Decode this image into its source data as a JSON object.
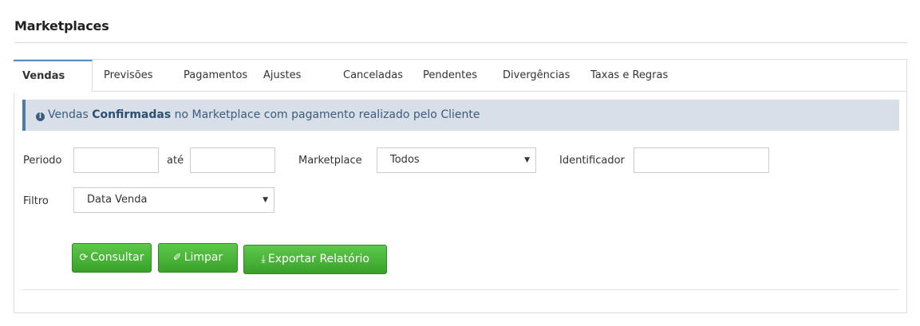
{
  "page": {
    "title": "Marketplaces"
  },
  "tabs": [
    {
      "label": "Vendas"
    },
    {
      "label": "Previsões"
    },
    {
      "label": "Pagamentos"
    },
    {
      "label": "Ajustes"
    },
    {
      "label": "Canceladas"
    },
    {
      "label": "Pendentes"
    },
    {
      "label": "Divergências"
    },
    {
      "label": "Taxas e Regras"
    }
  ],
  "active_tab": "Vendas",
  "info": {
    "icon": "info-circle-icon",
    "text_before": "Vendas ",
    "text_bold": "Confirmadas",
    "text_after": " no Marketplace com pagamento realizado pelo Cliente"
  },
  "filters": {
    "periodo_label": "Periodo",
    "periodo_from": "",
    "ate_label": "até",
    "periodo_to": "",
    "marketplace_label": "Marketplace",
    "marketplace_value": "Todos",
    "identificador_label": "Identificador",
    "identificador_value": "",
    "filtro_label": "Filtro",
    "filtro_value": "Data Venda"
  },
  "buttons": {
    "consultar": "Consultar",
    "limpar": "Limpar",
    "exportar": "Exportar Relatório"
  },
  "colors": {
    "accent": "#5c8dbb",
    "button_green": "#3aa12a",
    "info_bg": "#d8dfe8"
  }
}
